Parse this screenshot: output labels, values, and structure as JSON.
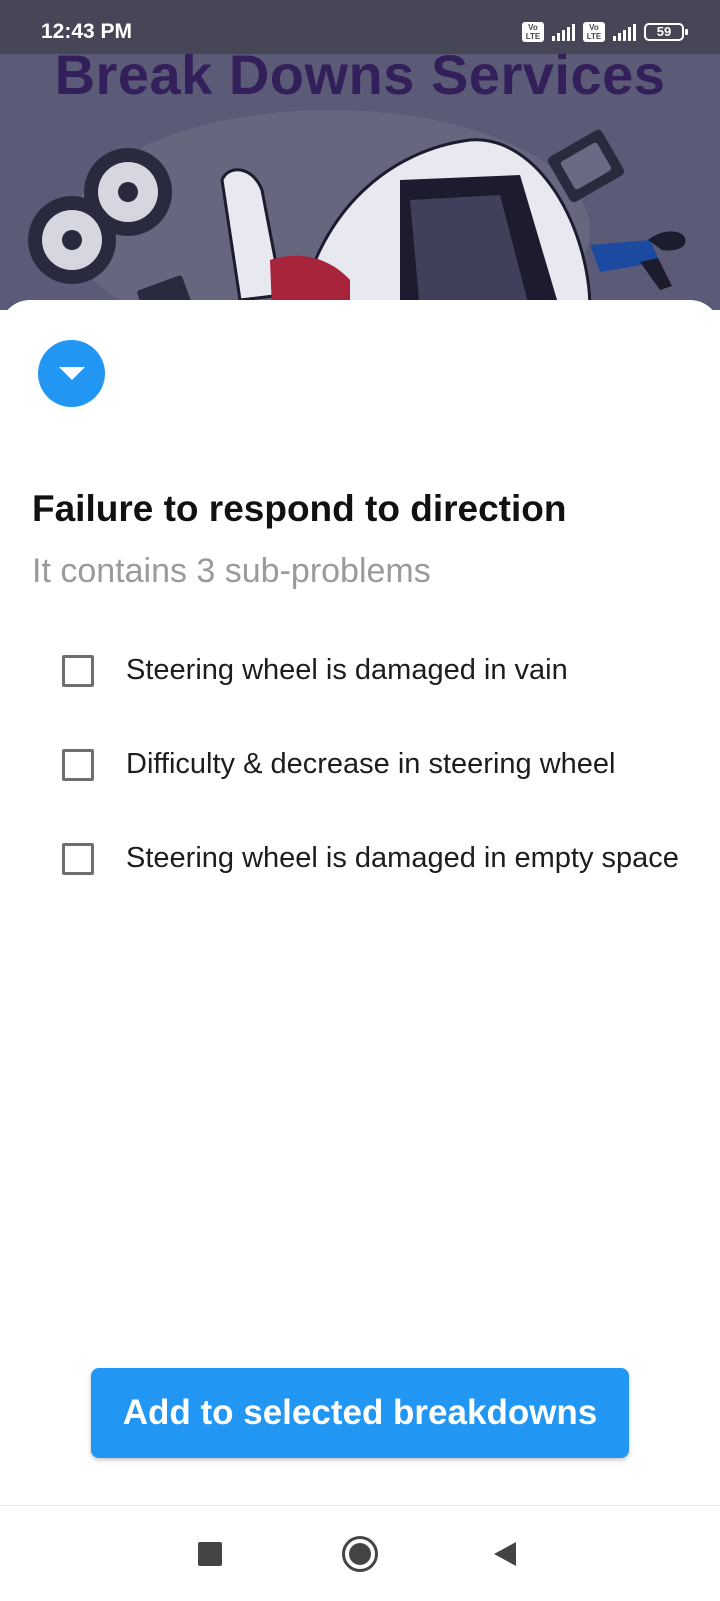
{
  "status_bar": {
    "time": "12:43 PM",
    "volte_1": "Vo LTE",
    "volte_2": "Vo LTE",
    "battery": "59"
  },
  "hero": {
    "title": "Break Downs Services"
  },
  "sheet": {
    "title": "Failure to respond to direction",
    "subtitle": "It contains 3 sub-problems",
    "items": [
      {
        "label": "Steering wheel is damaged in vain",
        "checked": false
      },
      {
        "label": "Difficulty & decrease in steering wheel",
        "checked": false
      },
      {
        "label": "Steering wheel is damaged in empty space",
        "checked": false
      }
    ],
    "add_button_label": "Add to selected breakdowns"
  },
  "colors": {
    "accent": "#2196f3",
    "hero_bg": "#5b5b78",
    "hero_title": "#33205a",
    "status_bar": "#464657"
  },
  "icons": {
    "collapse": "chevron-down-icon",
    "nav_recent": "square-icon",
    "nav_home": "circle-icon",
    "nav_back": "triangle-back-icon"
  }
}
